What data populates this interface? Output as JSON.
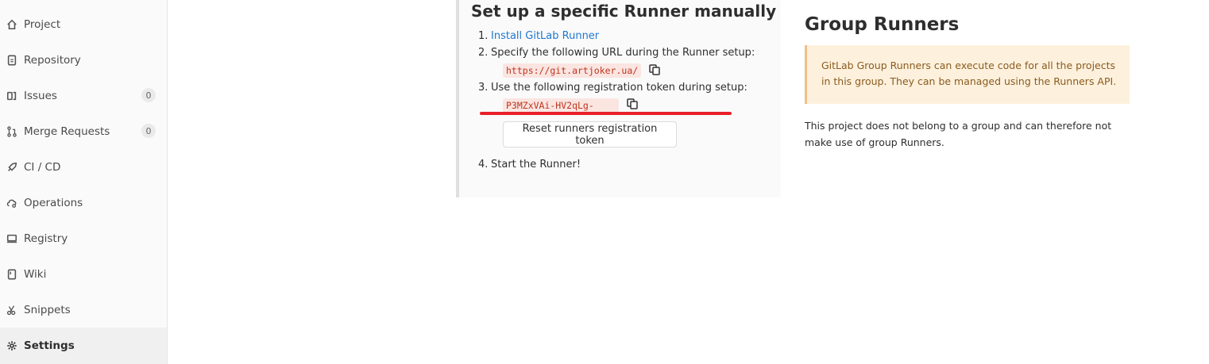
{
  "sidebar": {
    "items": [
      {
        "label": "Project",
        "icon": "home-icon"
      },
      {
        "label": "Repository",
        "icon": "document-icon"
      },
      {
        "label": "Issues",
        "icon": "issues-icon",
        "badge": "0"
      },
      {
        "label": "Merge Requests",
        "icon": "merge-request-icon",
        "badge": "0"
      },
      {
        "label": "CI / CD",
        "icon": "rocket-icon"
      },
      {
        "label": "Operations",
        "icon": "cloud-gear-icon"
      },
      {
        "label": "Registry",
        "icon": "container-icon"
      },
      {
        "label": "Wiki",
        "icon": "book-icon"
      },
      {
        "label": "Snippets",
        "icon": "scissors-icon"
      },
      {
        "label": "Settings",
        "icon": "gear-icon",
        "active": true
      }
    ]
  },
  "manual": {
    "title": "Set up a specific Runner manually",
    "step1_num": "1.",
    "step1_link": "Install GitLab Runner",
    "step2_num": "2.",
    "step2_text": "Specify the following URL during the Runner setup:",
    "url": "https://git.artjoker.ua/",
    "step3_num": "3.",
    "step3_text": "Use the following registration token during setup:",
    "token": "P3MZxVAi-HV2qLg-",
    "reset_button": "Reset runners registration token",
    "step4_num": "4.",
    "step4_text": "Start the Runner!"
  },
  "group": {
    "title": "Group Runners",
    "info": "GitLab Group Runners can execute code for all the projects in this group. They can be managed using the Runners API.",
    "note": "This project does not belong to a group and can therefore not make use of group Runners."
  },
  "colors": {
    "link": "#1f78d1",
    "code_text": "#c0341d",
    "code_bg": "#fbe5e1",
    "info_bg": "#fdf1dd",
    "info_text": "#8a5b1f",
    "annotation_red": "#e8202a"
  }
}
